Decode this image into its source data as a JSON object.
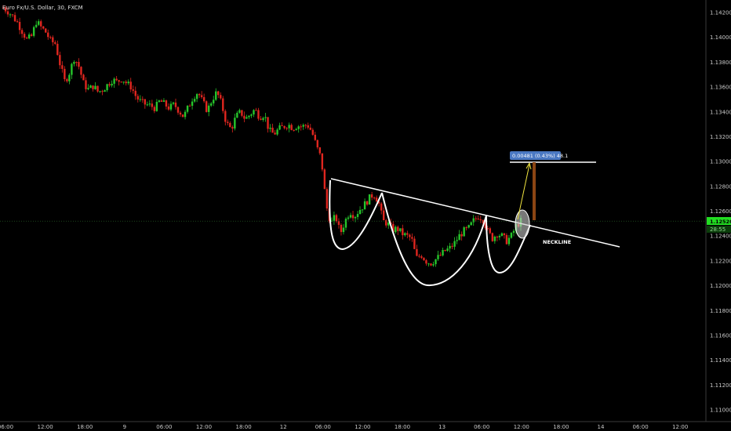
{
  "title": "Euro Fx/U.S. Dollar, 30, FXCM",
  "colors": {
    "background": "#000000",
    "up": "#26c62b",
    "down": "#e0261f",
    "drawing": "#ffffff",
    "measure_arrow": "#f2e640",
    "measure_box": "#8b4513",
    "label_bg": "#4a78c2",
    "price_tag": "#22dd22"
  },
  "chart_data": {
    "type": "candlestick",
    "symbol": "Euro Fx/U.S. Dollar",
    "timeframe": "30",
    "source": "FXCM",
    "y_axis": {
      "range": [
        1.109,
        1.143
      ],
      "ticks": [
        "1.14200",
        "1.14000",
        "1.13800",
        "1.13600",
        "1.13400",
        "1.13200",
        "1.13000",
        "1.12800",
        "1.12600",
        "1.12400",
        "1.12200",
        "1.12000",
        "1.11800",
        "1.11600",
        "1.11400",
        "1.11200",
        "1.11000"
      ]
    },
    "x_axis": {
      "ticks": [
        "06:00",
        "12:00",
        "18:00",
        "9",
        "06:00",
        "12:00",
        "18:00",
        "12",
        "06:00",
        "12:00",
        "18:00",
        "13",
        "06:00",
        "12:00",
        "18:00",
        "14",
        "06:00",
        "12:00"
      ]
    },
    "current_price": "1.12520",
    "countdown": "28:55",
    "price_path": [
      1.1424,
      1.1421,
      1.1417,
      1.1412,
      1.1405,
      1.1398,
      1.1401,
      1.1413,
      1.1408,
      1.1404,
      1.1397,
      1.1395,
      1.1378,
      1.1364,
      1.1372,
      1.1384,
      1.1376,
      1.1362,
      1.1358,
      1.1361,
      1.1356,
      1.1358,
      1.1362,
      1.1366,
      1.1364,
      1.1367,
      1.1363,
      1.136,
      1.1352,
      1.1348,
      1.1346,
      1.1345,
      1.1343,
      1.1349,
      1.1346,
      1.1343,
      1.1346,
      1.1341,
      1.1336,
      1.1344,
      1.1352,
      1.1356,
      1.1348,
      1.1341,
      1.135,
      1.1356,
      1.1346,
      1.1331,
      1.1326,
      1.1336,
      1.134,
      1.1334,
      1.1338,
      1.1342,
      1.1336,
      1.1338,
      1.1325,
      1.1322,
      1.1326,
      1.1328,
      1.133,
      1.1327,
      1.1329,
      1.1328,
      1.133,
      1.1324,
      1.1312,
      1.1302,
      1.1265,
      1.125,
      1.1256,
      1.1242,
      1.1252,
      1.126,
      1.1256,
      1.1261,
      1.1265,
      1.127,
      1.1274,
      1.1268,
      1.1252,
      1.125,
      1.1245,
      1.1246,
      1.1242,
      1.124,
      1.1238,
      1.1222,
      1.1225,
      1.122,
      1.1218,
      1.1221,
      1.1224,
      1.1228,
      1.123,
      1.1234,
      1.124,
      1.1244,
      1.1246,
      1.1252,
      1.1256,
      1.1254,
      1.1244,
      1.1238,
      1.1242,
      1.124,
      1.1236,
      1.124,
      1.1248,
      1.1252
    ],
    "annotations": {
      "neckline_label": "NECKLINE",
      "measure_label": "0.00481 (0.43%) 48.1",
      "neckline": {
        "from": [
          0,
          1.1288
        ],
        "to": [
          1,
          1.1233
        ]
      },
      "target_level": 1.13,
      "pattern": "inverse head and shoulders"
    }
  }
}
